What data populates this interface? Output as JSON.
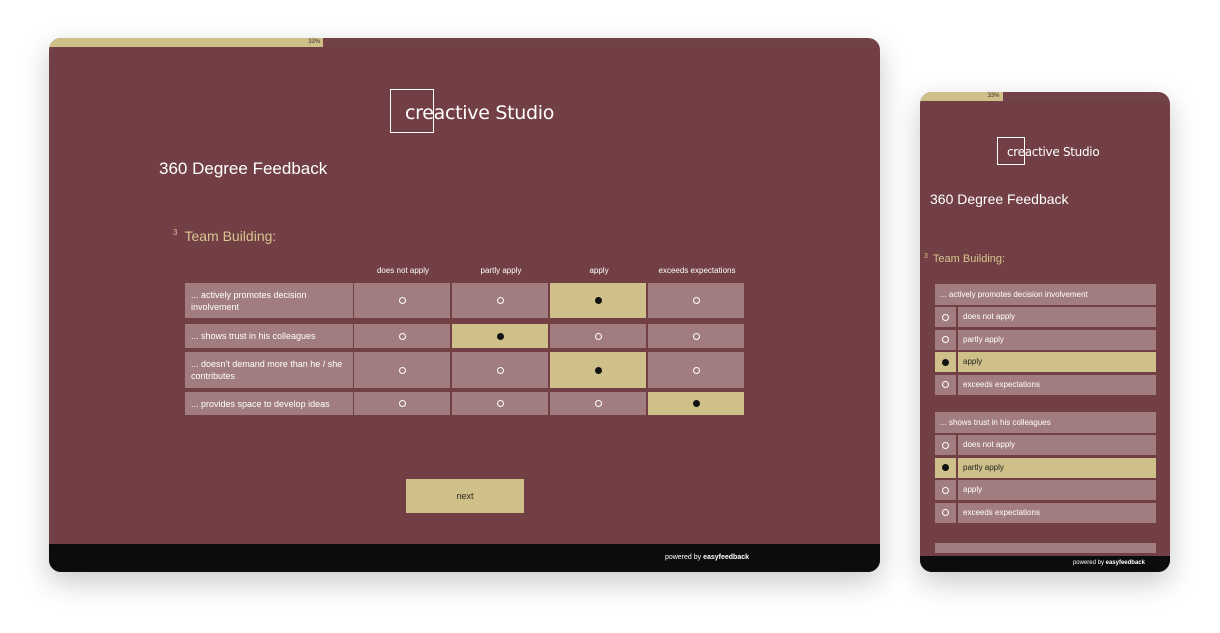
{
  "progress": {
    "label": "33%",
    "fraction": 0.33
  },
  "brand": {
    "logo_text": "creactive Studio"
  },
  "survey": {
    "title": "360 Degree Feedback"
  },
  "question": {
    "number": "3",
    "title": "Team Building:"
  },
  "scale": [
    "does not apply",
    "partly apply",
    "apply",
    "exceeds expectations"
  ],
  "rows": [
    {
      "label": "... actively promotes decision involvement",
      "selected": 2
    },
    {
      "label": "... shows trust in his colleagues",
      "selected": 1
    },
    {
      "label": "... doesn't demand more than he / she contributes",
      "selected": 2
    },
    {
      "label": "... provides space to develop ideas",
      "selected": 3
    }
  ],
  "next_button": "next",
  "footer": {
    "prefix": "powered by ",
    "brand": "easyfeedback"
  },
  "colors": {
    "background": "#713f44",
    "cell": "#a27d80",
    "accent": "#cfc08a",
    "footer": "#0c0c0c"
  }
}
